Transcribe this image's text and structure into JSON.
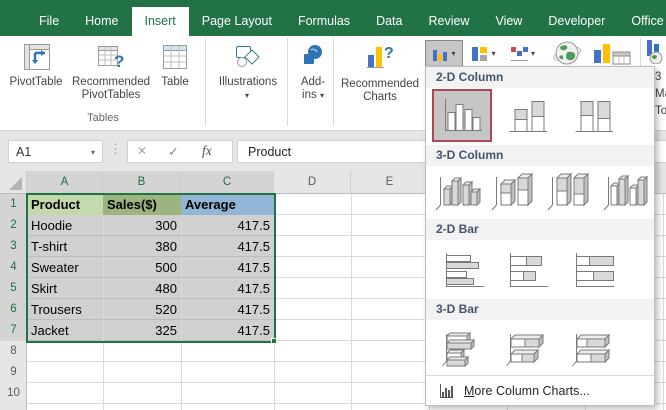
{
  "tabs": [
    {
      "label": "File"
    },
    {
      "label": "Home"
    },
    {
      "label": "Insert"
    },
    {
      "label": "Page Layout"
    },
    {
      "label": "Formulas"
    },
    {
      "label": "Data"
    },
    {
      "label": "Review"
    },
    {
      "label": "View"
    },
    {
      "label": "Developer"
    },
    {
      "label": "Office Tab"
    }
  ],
  "ribbon": {
    "pivottable": "PivotTable",
    "rec_pivot_line1": "Recommended",
    "rec_pivot_line2": "PivotTables",
    "table": "Table",
    "tables_group": "Tables",
    "illustrations": "Illustrations",
    "addins_line1": "Add-",
    "addins_line2": "ins",
    "rec_charts_line1": "Recommended",
    "rec_charts_line2": "Charts",
    "map_frag_1": "3",
    "map_frag_2": "Ma",
    "map_frag_3": "To"
  },
  "formula_bar": {
    "name_box": "A1",
    "cancel_icon": "✕",
    "enter_icon": "✓",
    "fx": "fx",
    "value": "Product",
    "name_arrow": "▾"
  },
  "sheet": {
    "columns": [
      "A",
      "B",
      "C",
      "D",
      "E"
    ],
    "rows": [
      {
        "n": "1",
        "a": "Product",
        "b": "Sales($)",
        "c": "Average"
      },
      {
        "n": "2",
        "a": "Hoodie",
        "b": "300",
        "c": "417.5"
      },
      {
        "n": "3",
        "a": "T-shirt",
        "b": "380",
        "c": "417.5"
      },
      {
        "n": "4",
        "a": "Sweater",
        "b": "500",
        "c": "417.5"
      },
      {
        "n": "5",
        "a": "Skirt",
        "b": "480",
        "c": "417.5"
      },
      {
        "n": "6",
        "a": "Trousers",
        "b": "520",
        "c": "417.5"
      },
      {
        "n": "7",
        "a": "Jacket",
        "b": "325",
        "c": "417.5"
      },
      {
        "n": "8"
      },
      {
        "n": "9"
      },
      {
        "n": "10"
      }
    ]
  },
  "dropdown": {
    "sections": [
      {
        "title": "2-D Column"
      },
      {
        "title": "3-D Column"
      },
      {
        "title": "2-D Bar"
      },
      {
        "title": "3-D Bar"
      }
    ],
    "more_pre": "M",
    "more_rest": "ore Column Charts..."
  },
  "colors": {
    "excel_green": "#217346",
    "selected_thumb_border": "#b0464f",
    "series_blue": "#4472c4",
    "series_yellow": "#ffc000"
  }
}
